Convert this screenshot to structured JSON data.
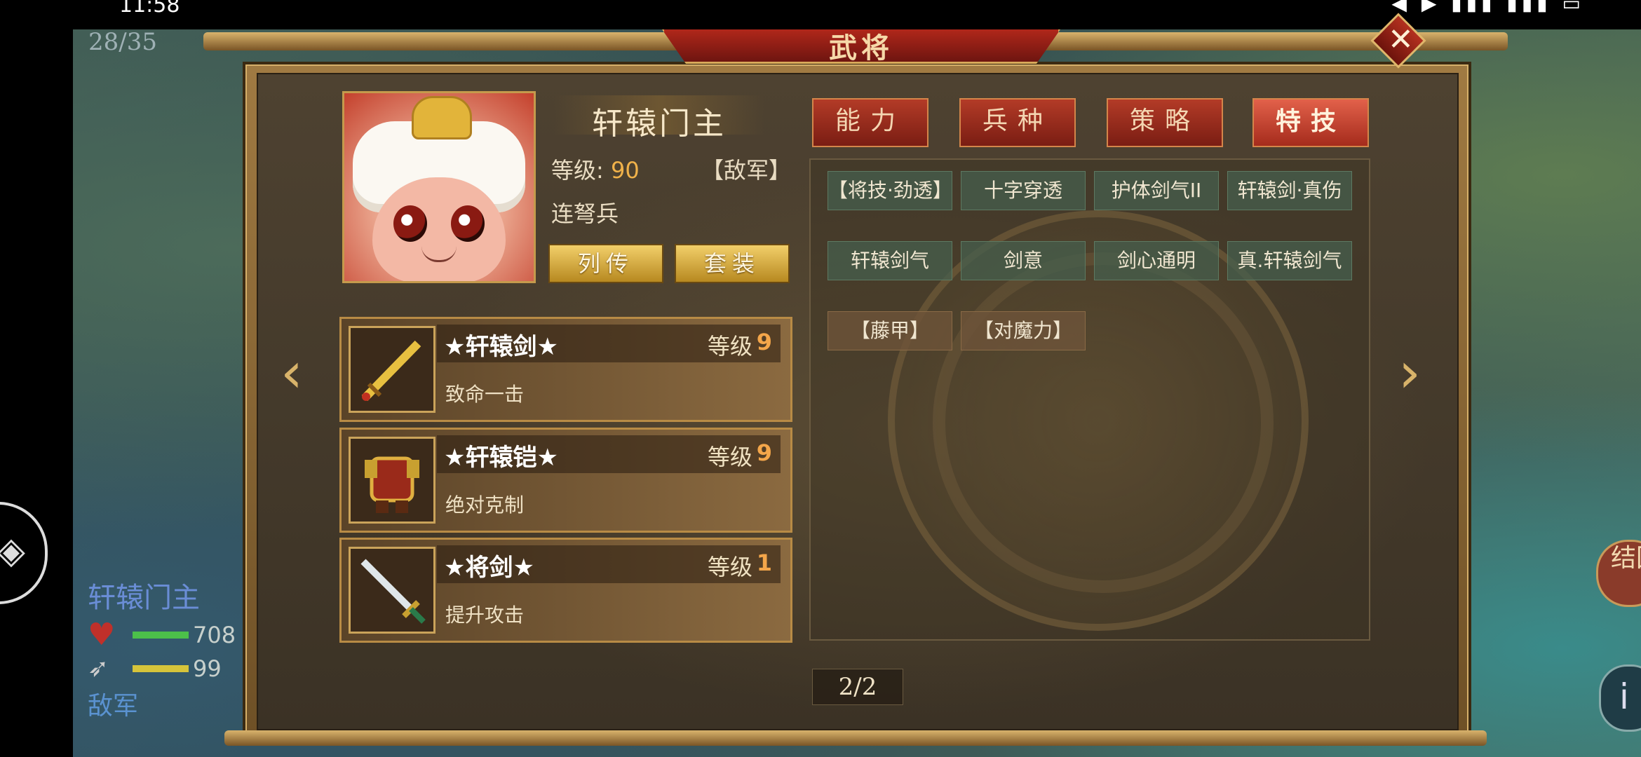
{
  "status_bar": {
    "time": "11:58",
    "icons": "◀ ▶ ▮▮▮ ▮▮▮ ▭"
  },
  "background": {
    "turn_counter": "28/35",
    "unit": {
      "name": "轩辕门主",
      "hp": "708",
      "mp": "99",
      "side": "敌军"
    },
    "right_button": "结回"
  },
  "dialog": {
    "title": "武将",
    "close_label": "✕",
    "general": {
      "name": "轩辕门主",
      "level_label": "等级:",
      "level": "90",
      "side_tag": "【敌军】",
      "unit_type": "连弩兵",
      "biography_button": "列传",
      "set_button": "套装"
    },
    "tabs": [
      {
        "label": "能力",
        "active": false
      },
      {
        "label": "兵种",
        "active": false
      },
      {
        "label": "策略",
        "active": false
      },
      {
        "label": "特技",
        "active": true
      }
    ],
    "skills": [
      "【将技·劲透】",
      "十字穿透",
      "护体剑气II",
      "轩辕剑·真伤",
      "轩辕剑气",
      "剑意",
      "剑心通明",
      "真.轩辕剑气",
      "【藤甲】",
      "【对魔力】"
    ],
    "equipment": [
      {
        "name": "★轩辕剑★",
        "level_label": "等级",
        "level": "9",
        "effect": "致命一击",
        "icon": "golden-sword-icon"
      },
      {
        "name": "★轩辕铠★",
        "level_label": "等级",
        "level": "9",
        "effect": "绝对克制",
        "icon": "armor-icon"
      },
      {
        "name": "★将剑★",
        "level_label": "等级",
        "level": "1",
        "effect": "提升攻击",
        "icon": "sword-icon"
      }
    ],
    "prev_arrow": "‹",
    "next_arrow": "›",
    "page_indicator": "2/2"
  },
  "colors": {
    "accent_red": "#b33b27",
    "gold": "#d8b36a",
    "level_orange": "#f4a64a"
  }
}
